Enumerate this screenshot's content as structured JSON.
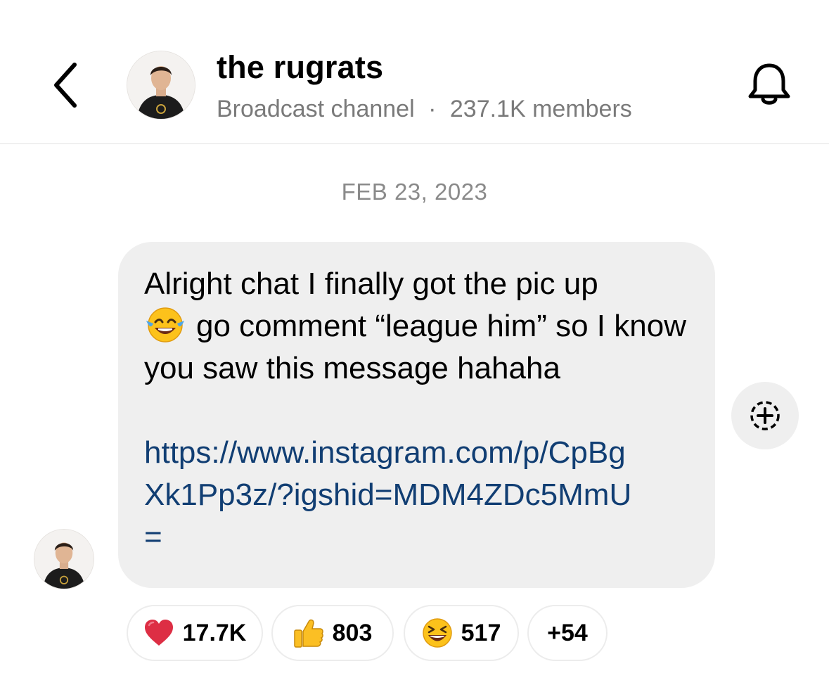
{
  "header": {
    "title": "the rugrats",
    "channel_type": "Broadcast channel",
    "separator": "·",
    "members": "237.1K members",
    "back_icon": "chevron-left-icon",
    "bell_icon": "bell-icon"
  },
  "thread": {
    "date": "FEB 23, 2023",
    "message": {
      "line1": "Alright chat I finally got the pic up",
      "emoji": "face-with-tears-of-joy",
      "line2": "go comment “league him” so I know you saw this message hahaha",
      "link": "https://www.instagram.com/p/CpBgXk1Pp3z/?igshid=MDM4ZDc5MmU="
    },
    "add_reaction_icon": "add-reaction-icon"
  },
  "reactions": [
    {
      "emoji": "heart",
      "count": "17.7K"
    },
    {
      "emoji": "thumbs-up",
      "count": "803"
    },
    {
      "emoji": "grinning-squinting-face",
      "count": "517"
    },
    {
      "emoji": "",
      "count": "+54"
    }
  ],
  "colors": {
    "bubble": "#efefef",
    "link": "#113e73",
    "secondary_text": "#7a7a7a"
  }
}
